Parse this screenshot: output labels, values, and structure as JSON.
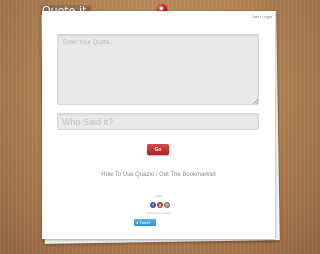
{
  "brand": {
    "name": "Quote it",
    "accent": "!"
  },
  "header": {
    "join": "Join",
    "separator": "|",
    "login": "Login"
  },
  "form": {
    "quote_placeholder": "Enter Your Quote...",
    "author_placeholder": "Who Said it?",
    "go_label": "Go"
  },
  "help": {
    "how_to": "How To Use Quazio",
    "separator": "/",
    "bookmarklet": "Get The Bookmarklet"
  },
  "share": {
    "label": "share",
    "icons": [
      "facebook-icon",
      "google-plus-icon",
      "email-icon"
    ],
    "credit": "a project by quazio",
    "tweet_label": "Tweet"
  },
  "colors": {
    "pin": "#d32020",
    "go_button": "#c62b2b",
    "tweet_button": "#2a91d4",
    "background": "#b07f52"
  }
}
